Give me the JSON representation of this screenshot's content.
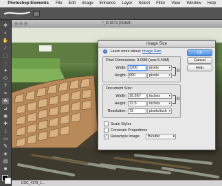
{
  "menubar": {
    "app_name": "Photoshop Elements",
    "items": [
      "File",
      "Edit",
      "Image",
      "Enhance",
      "Layer",
      "Select",
      "Filter",
      "View",
      "Window",
      "Help"
    ]
  },
  "document": {
    "title": "*_ID 8573 (RGB/8)",
    "status": "DSC_4178_1..."
  },
  "dialog": {
    "title": "Image Size",
    "learn_prefix": "Learn more about:",
    "learn_link": "Image Size",
    "pixel_dimensions": {
      "title": "Pixel Dimensions: 3.09M (was 5.49M)",
      "width_label": "Width:",
      "width_value": "1200",
      "width_unit": "pixels",
      "height_label": "Height:",
      "height_value": "900",
      "height_unit": "pixels"
    },
    "document_size": {
      "title": "Document Size:",
      "width_label": "Width:",
      "width_value": "16.667",
      "width_unit": "inches",
      "height_label": "Height:",
      "height_value": "12.5",
      "height_unit": "inches",
      "resolution_label": "Resolution:",
      "resolution_value": "72",
      "resolution_unit": "pixels/inch"
    },
    "scale_styles": {
      "label": "Scale Styles",
      "checked": false
    },
    "constrain": {
      "label": "Constrain Proportions",
      "checked": false
    },
    "resample": {
      "label": "Resample Image:",
      "checked": true,
      "method": "Bicubic"
    },
    "buttons": {
      "ok": "OK",
      "cancel": "Cancel",
      "help": "Help"
    }
  },
  "colors": {
    "accent": "#4a8de0",
    "link": "#1f4fb0"
  }
}
